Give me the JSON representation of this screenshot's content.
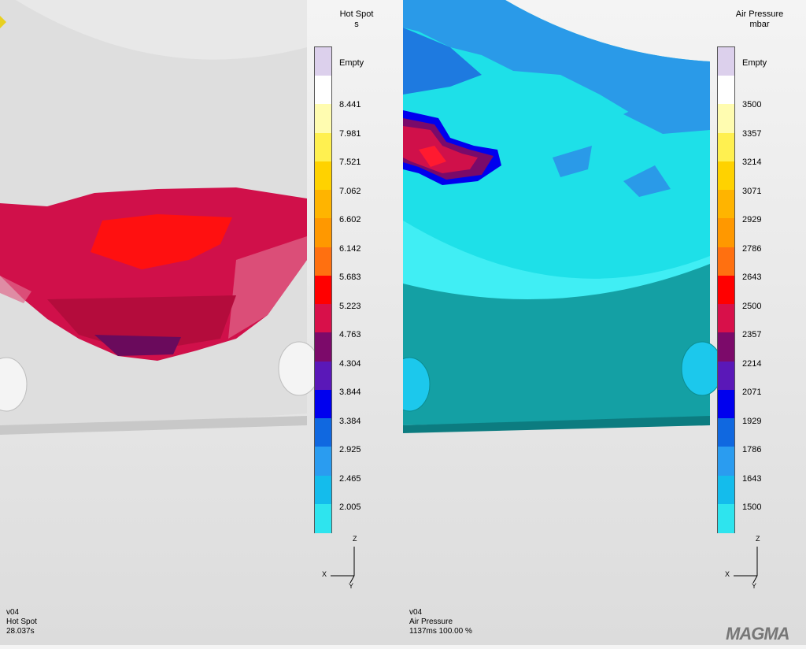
{
  "left": {
    "legend": {
      "title": "Hot Spot",
      "unit": "s",
      "empty_label": "Empty",
      "labels": [
        "8.441",
        "7.981",
        "7.521",
        "7.062",
        "6.602",
        "6.142",
        "5.683",
        "5.223",
        "4.763",
        "4.304",
        "3.844",
        "3.384",
        "2.925",
        "2.465",
        "2.005"
      ],
      "colors": [
        "#dcd0ec",
        "#ffffff",
        "#fffcb0",
        "#fff050",
        "#ffd200",
        "#ffb400",
        "#ff9800",
        "#ff7010",
        "#ff0000",
        "#d8104a",
        "#7c0a6a",
        "#5a18b8",
        "#0000ee",
        "#1068e0",
        "#2a9cf0",
        "#14bcec",
        "#2ee4ee"
      ]
    },
    "axis": {
      "z": "Z",
      "x": "X",
      "y": "Y"
    },
    "info": {
      "line1": "v04",
      "line2": "Hot Spot",
      "line3": "28.037s"
    }
  },
  "right": {
    "legend": {
      "title": "Air Pressure",
      "unit": "mbar",
      "empty_label": "Empty",
      "labels": [
        "3500",
        "3357",
        "3214",
        "3071",
        "2929",
        "2786",
        "2643",
        "2500",
        "2357",
        "2214",
        "2071",
        "1929",
        "1786",
        "1643",
        "1500"
      ],
      "colors": [
        "#dcd0ec",
        "#ffffff",
        "#fffcb0",
        "#fff050",
        "#ffd200",
        "#ffb400",
        "#ff9800",
        "#ff7010",
        "#ff0000",
        "#d8104a",
        "#7c0a6a",
        "#5a18b8",
        "#0000ee",
        "#1068e0",
        "#2a9cf0",
        "#14bcec",
        "#2ee4ee"
      ]
    },
    "axis": {
      "z": "Z",
      "x": "X",
      "y": "Y"
    },
    "info": {
      "line1": "v04",
      "line2": "Air Pressure",
      "line3": "1137ms 100.00 %"
    }
  },
  "logo": {
    "text": "MAGMA"
  }
}
